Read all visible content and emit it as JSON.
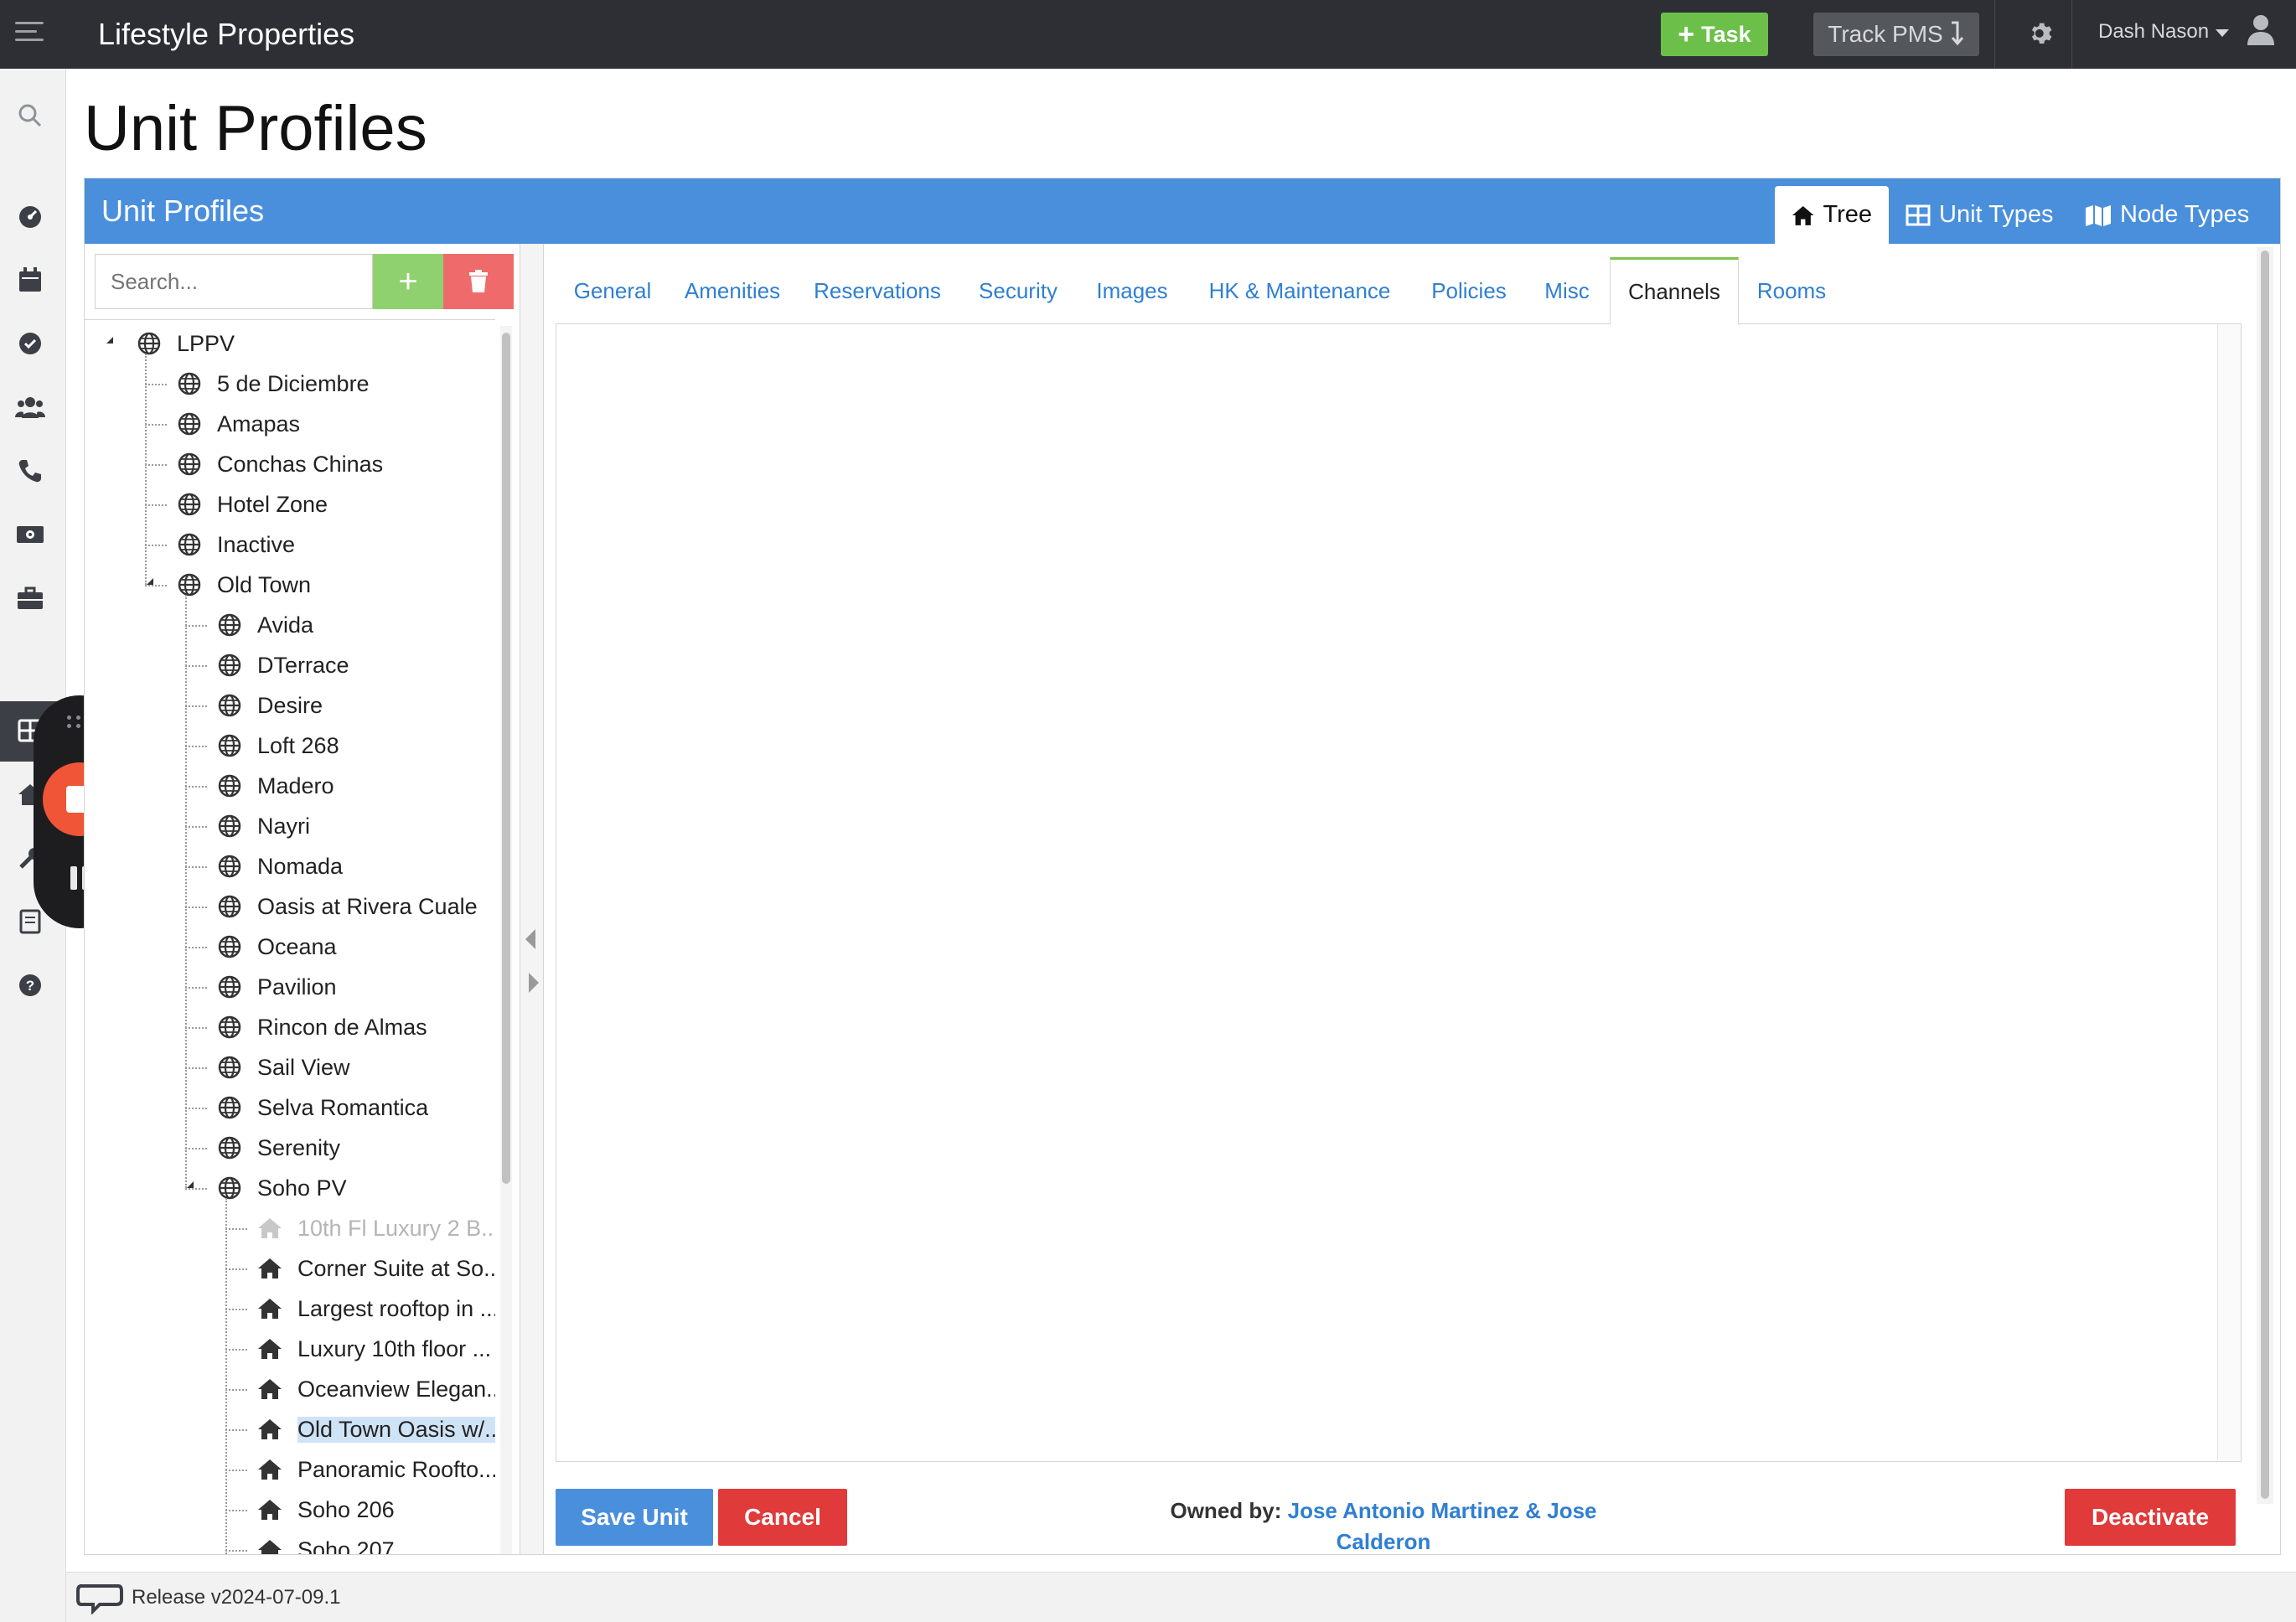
{
  "app": {
    "title": "Lifestyle Properties"
  },
  "topbar": {
    "task_label": "Task",
    "track_label": "Track PMS",
    "user_name": "Dash Nason"
  },
  "page": {
    "title": "Unit Profiles"
  },
  "panel": {
    "title": "Unit Profiles",
    "view_tabs": [
      {
        "label": "Tree",
        "icon": "home-icon",
        "active": true
      },
      {
        "label": "Unit Types",
        "icon": "grid-icon",
        "active": false
      },
      {
        "label": "Node Types",
        "icon": "map-icon",
        "active": false
      }
    ]
  },
  "tree": {
    "search_placeholder": "Search...",
    "nodes": [
      {
        "label": "LPPV",
        "level": 0,
        "type": "globe",
        "expanded": true
      },
      {
        "label": "5 de Diciembre",
        "level": 1,
        "type": "globe"
      },
      {
        "label": "Amapas",
        "level": 1,
        "type": "globe"
      },
      {
        "label": "Conchas Chinas",
        "level": 1,
        "type": "globe"
      },
      {
        "label": "Hotel Zone",
        "level": 1,
        "type": "globe"
      },
      {
        "label": "Inactive",
        "level": 1,
        "type": "globe"
      },
      {
        "label": "Old Town",
        "level": 1,
        "type": "globe",
        "expanded": true
      },
      {
        "label": "Avida",
        "level": 2,
        "type": "globe"
      },
      {
        "label": "DTerrace",
        "level": 2,
        "type": "globe"
      },
      {
        "label": "Desire",
        "level": 2,
        "type": "globe"
      },
      {
        "label": "Loft 268",
        "level": 2,
        "type": "globe"
      },
      {
        "label": "Madero",
        "level": 2,
        "type": "globe"
      },
      {
        "label": "Nayri",
        "level": 2,
        "type": "globe"
      },
      {
        "label": "Nomada",
        "level": 2,
        "type": "globe"
      },
      {
        "label": "Oasis at Rivera Cuale",
        "level": 2,
        "type": "globe"
      },
      {
        "label": "Oceana",
        "level": 2,
        "type": "globe"
      },
      {
        "label": "Pavilion",
        "level": 2,
        "type": "globe"
      },
      {
        "label": "Rincon de Almas",
        "level": 2,
        "type": "globe"
      },
      {
        "label": "Sail View",
        "level": 2,
        "type": "globe"
      },
      {
        "label": "Selva Romantica",
        "level": 2,
        "type": "globe"
      },
      {
        "label": "Serenity",
        "level": 2,
        "type": "globe"
      },
      {
        "label": "Soho PV",
        "level": 2,
        "type": "globe",
        "expanded": true
      },
      {
        "label": "10th Fl Luxury 2 B...",
        "level": 3,
        "type": "home",
        "muted": true
      },
      {
        "label": "Corner Suite at So...",
        "level": 3,
        "type": "home"
      },
      {
        "label": "Largest rooftop in ...",
        "level": 3,
        "type": "home"
      },
      {
        "label": "Luxury 10th floor ...",
        "level": 3,
        "type": "home"
      },
      {
        "label": "Oceanview Elegan...",
        "level": 3,
        "type": "home"
      },
      {
        "label": "Old Town Oasis w/...",
        "level": 3,
        "type": "home",
        "selected": true
      },
      {
        "label": "Panoramic Roofto...",
        "level": 3,
        "type": "home"
      },
      {
        "label": "Soho 206",
        "level": 3,
        "type": "home"
      },
      {
        "label": "Soho 207",
        "level": 3,
        "type": "home"
      }
    ]
  },
  "content": {
    "tabs": [
      {
        "label": "General"
      },
      {
        "label": "Amenities"
      },
      {
        "label": "Reservations"
      },
      {
        "label": "Security"
      },
      {
        "label": "Images"
      },
      {
        "label": "HK & Maintenance"
      },
      {
        "label": "Policies"
      },
      {
        "label": "Misc"
      },
      {
        "label": "Channels",
        "active": true
      },
      {
        "label": "Rooms"
      }
    ],
    "save_label": "Save Unit",
    "cancel_label": "Cancel",
    "deactivate_label": "Deactivate",
    "owned_label": "Owned by:",
    "owner_name": "Jose Antonio Martinez & Jose Calderon"
  },
  "footer": {
    "release": "Release v2024-07-09.1"
  },
  "colors": {
    "primary": "#4a8fdc",
    "success": "#6cc04a",
    "danger": "#e03a3a",
    "topbar": "#2d2f34",
    "recorder_stop": "#f05537"
  },
  "sidebar_icons": [
    "search-icon",
    "dashboard-icon",
    "calendar-icon",
    "check-circle-icon",
    "users-icon",
    "phone-icon",
    "money-icon",
    "briefcase-icon",
    "grid-icon",
    "home-icon",
    "wrench-icon",
    "report-icon",
    "help-icon"
  ]
}
